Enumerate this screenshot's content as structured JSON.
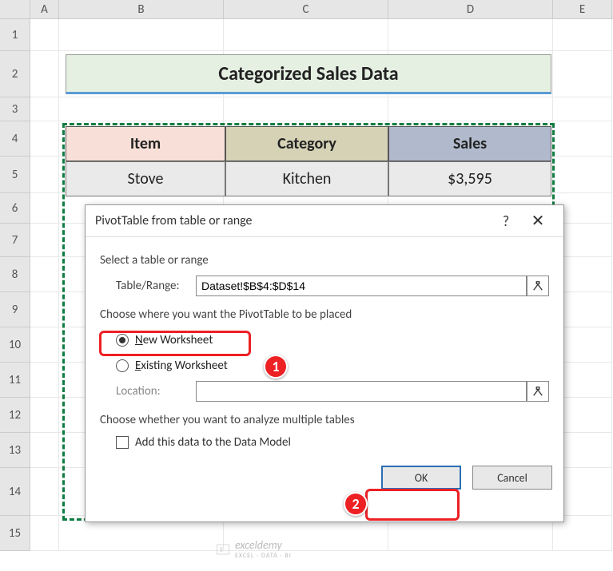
{
  "cols": [
    "A",
    "B",
    "C",
    "D",
    "E"
  ],
  "rows": [
    "1",
    "2",
    "3",
    "4",
    "5",
    "6",
    "7",
    "8",
    "9",
    "10",
    "11",
    "12",
    "13",
    "14",
    "15"
  ],
  "title": "Categorized Sales Data",
  "table": {
    "headers": [
      "Item",
      "Category",
      "Sales"
    ],
    "row1": [
      "Stove",
      "Kitchen",
      "$3,595"
    ]
  },
  "dialog": {
    "title": "PivotTable from table or range",
    "section1": "Select a table or range",
    "table_range_label": "Table/Range:",
    "table_range_value": "Dataset!$B$4:$D$14",
    "section2": "Choose where you want the PivotTable to be placed",
    "radio_new": "New Worksheet",
    "radio_existing": "Existing Worksheet",
    "location_label": "Location:",
    "location_value": "",
    "section3": "Choose whether you want to analyze multiple tables",
    "check_label": "Add this data to the Data Model",
    "ok": "OK",
    "cancel": "Cancel",
    "help": "?",
    "close": "✕"
  },
  "callouts": {
    "one": "1",
    "two": "2"
  },
  "watermark": "exceldemy",
  "watermark_sub": "EXCEL · DATA · BI"
}
